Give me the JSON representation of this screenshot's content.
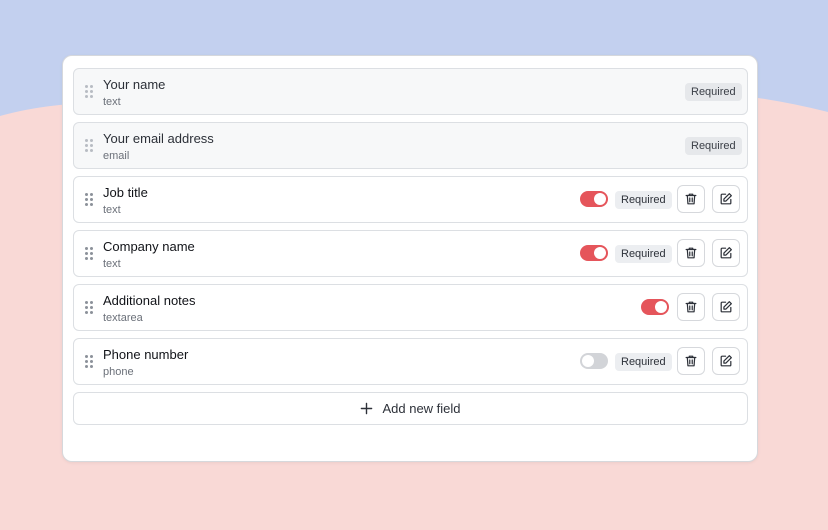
{
  "colors": {
    "background_top": "#c3d0ef",
    "background_bottom": "#f9d9d6",
    "toggle_on": "#e5555b",
    "toggle_off": "#d2d4d8"
  },
  "fields": [
    {
      "title": "Your name",
      "type": "text",
      "locked": true,
      "badge": "Required"
    },
    {
      "title": "Your email address",
      "type": "email",
      "locked": true,
      "badge": "Required"
    },
    {
      "title": "Job title",
      "type": "text",
      "locked": false,
      "toggle_on": true,
      "badge": "Required"
    },
    {
      "title": "Company name",
      "type": "text",
      "locked": false,
      "toggle_on": true,
      "badge": "Required"
    },
    {
      "title": "Additional notes",
      "type": "textarea",
      "locked": false,
      "toggle_on": true,
      "badge": null
    },
    {
      "title": "Phone number",
      "type": "phone",
      "locked": false,
      "toggle_on": false,
      "badge": "Required"
    }
  ],
  "icons": {
    "drag": "drag-handle-icon",
    "delete": "trash-icon",
    "edit": "edit-icon",
    "add": "plus-icon"
  },
  "add_button": {
    "label": "Add new field"
  }
}
